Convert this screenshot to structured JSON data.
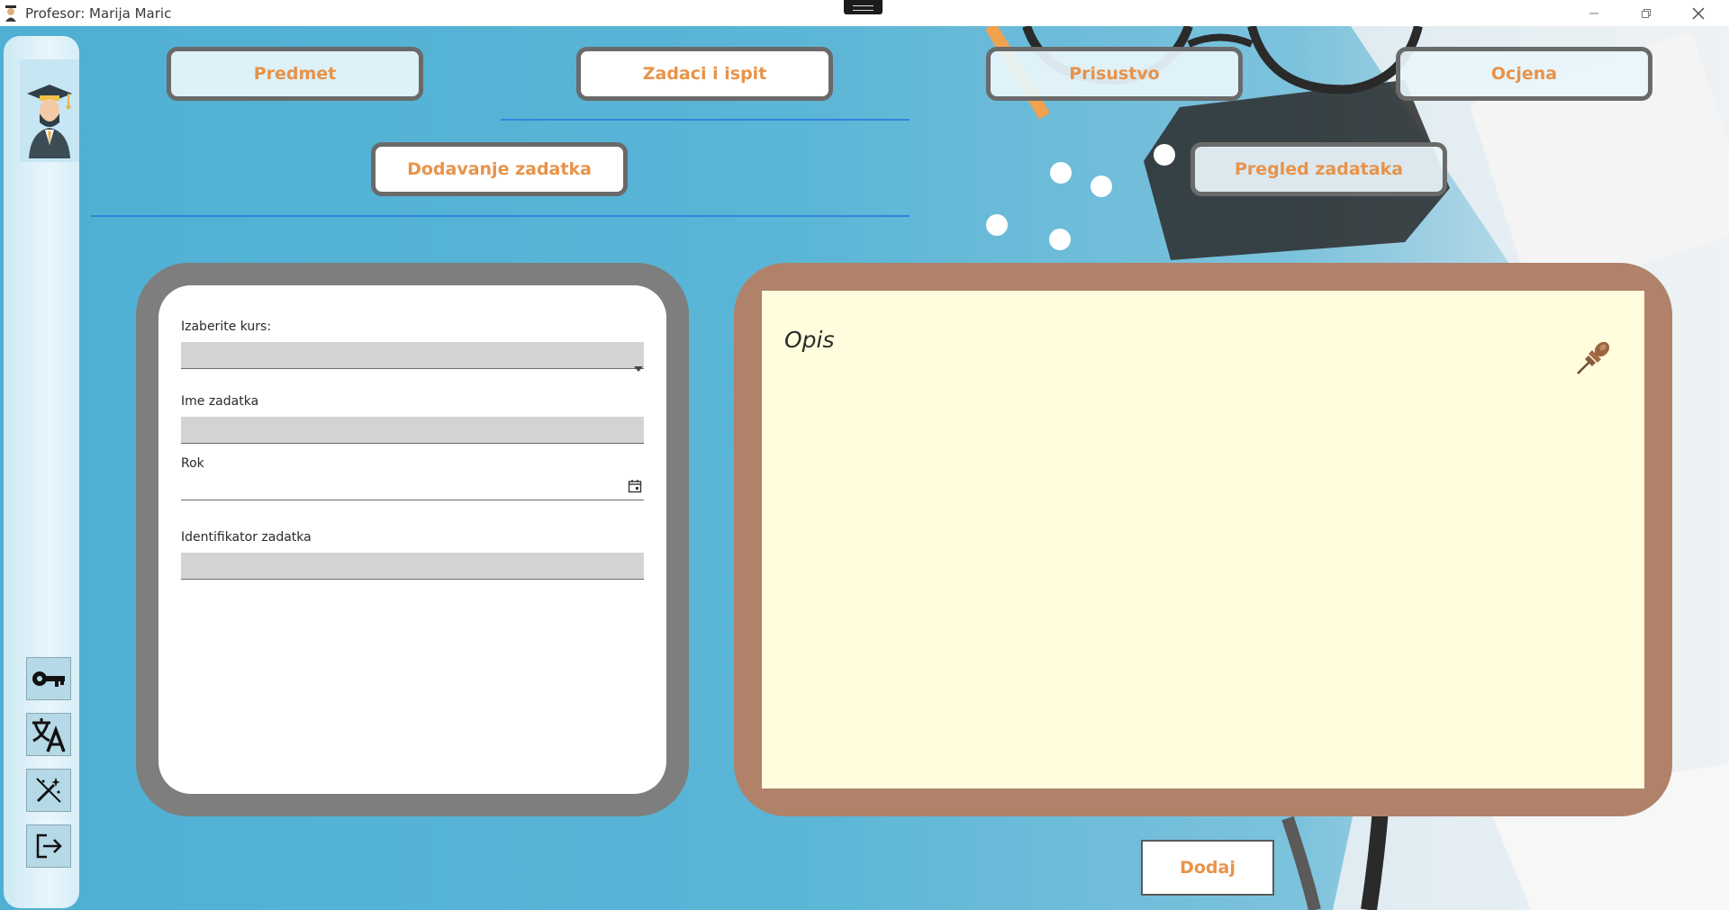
{
  "window": {
    "title": "Profesor: Marija Maric",
    "controls": [
      "minimize",
      "restore",
      "close"
    ]
  },
  "sidebar": {
    "avatar": "professor-avatar",
    "buttons": [
      {
        "icon": "key-icon",
        "name": "change-password-button"
      },
      {
        "icon": "translate-icon",
        "name": "language-button"
      },
      {
        "icon": "theme-wand-icon",
        "name": "theme-button"
      },
      {
        "icon": "logout-icon",
        "name": "logout-button"
      }
    ]
  },
  "main_tabs": [
    {
      "label": "Predmet",
      "active": false
    },
    {
      "label": "Zadaci i ispit",
      "active": true
    },
    {
      "label": "Prisustvo",
      "active": false
    },
    {
      "label": "Ocjena",
      "active": false
    }
  ],
  "sub_tabs": [
    {
      "label": "Dodavanje zadatka",
      "active": true
    },
    {
      "label": "Pregled zadataka",
      "active": false
    }
  ],
  "form": {
    "course_label": "Izaberite kurs:",
    "course_value": "",
    "name_label": "Ime zadatka",
    "name_value": "",
    "deadline_label": "Rok",
    "deadline_value": "",
    "identifier_label": "Identifikator zadatka",
    "identifier_value": ""
  },
  "description": {
    "label": "Opis",
    "value": ""
  },
  "actions": {
    "add_label": "Dodaj"
  },
  "colors": {
    "accent_text": "#e8934a",
    "tab_underline": "#2e86de",
    "form_frame": "#7e7e7e",
    "board_frame": "#b0826a",
    "paper": "#fffddd"
  }
}
